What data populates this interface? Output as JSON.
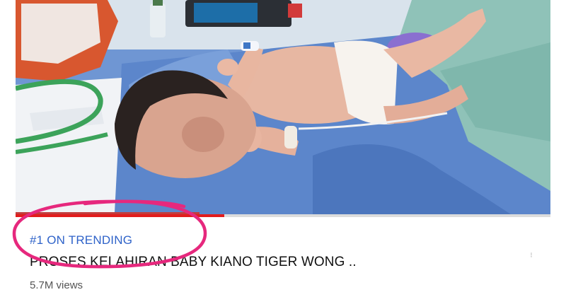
{
  "video": {
    "badge": "#1 ON TRENDING",
    "title": "PROSES KELAHIRAN BABY KIANO TIGER WONG ..",
    "views": "5.7M views",
    "progress_fraction": 0.39
  },
  "icons": {
    "menu": "more-vert-icon"
  },
  "colors": {
    "badge": "#2f63c9",
    "progress": "#e21c1c",
    "highlight_circle": "#e6287d"
  }
}
